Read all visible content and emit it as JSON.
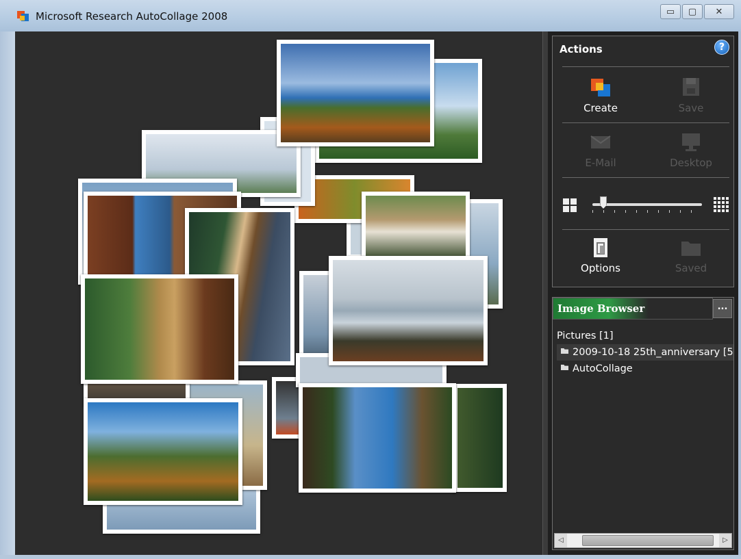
{
  "window": {
    "title": "Microsoft Research AutoCollage 2008",
    "buttons": {
      "minimize": "▭",
      "maximize": "▢",
      "close": "✕"
    }
  },
  "actions": {
    "tab_label": "Actions",
    "help_label": "?",
    "create_label": "Create",
    "save_label": "Save",
    "email_label": "E-Mail",
    "desktop_label": "Desktop",
    "options_label": "Options",
    "saved_label": "Saved",
    "slider_level": 0.1
  },
  "image_browser": {
    "title": "Image Browser",
    "more_button": "...",
    "root": "Pictures  [1]",
    "folders": [
      "2009-10-18 25th_anniversary  [54",
      "AutoCollage"
    ]
  },
  "scrollbar": {
    "left": "◁",
    "right": "▷"
  },
  "colors": {
    "canvas": "#2d2d2d",
    "panel": "#2a2a2a",
    "accent_green": "#2e9a45"
  }
}
